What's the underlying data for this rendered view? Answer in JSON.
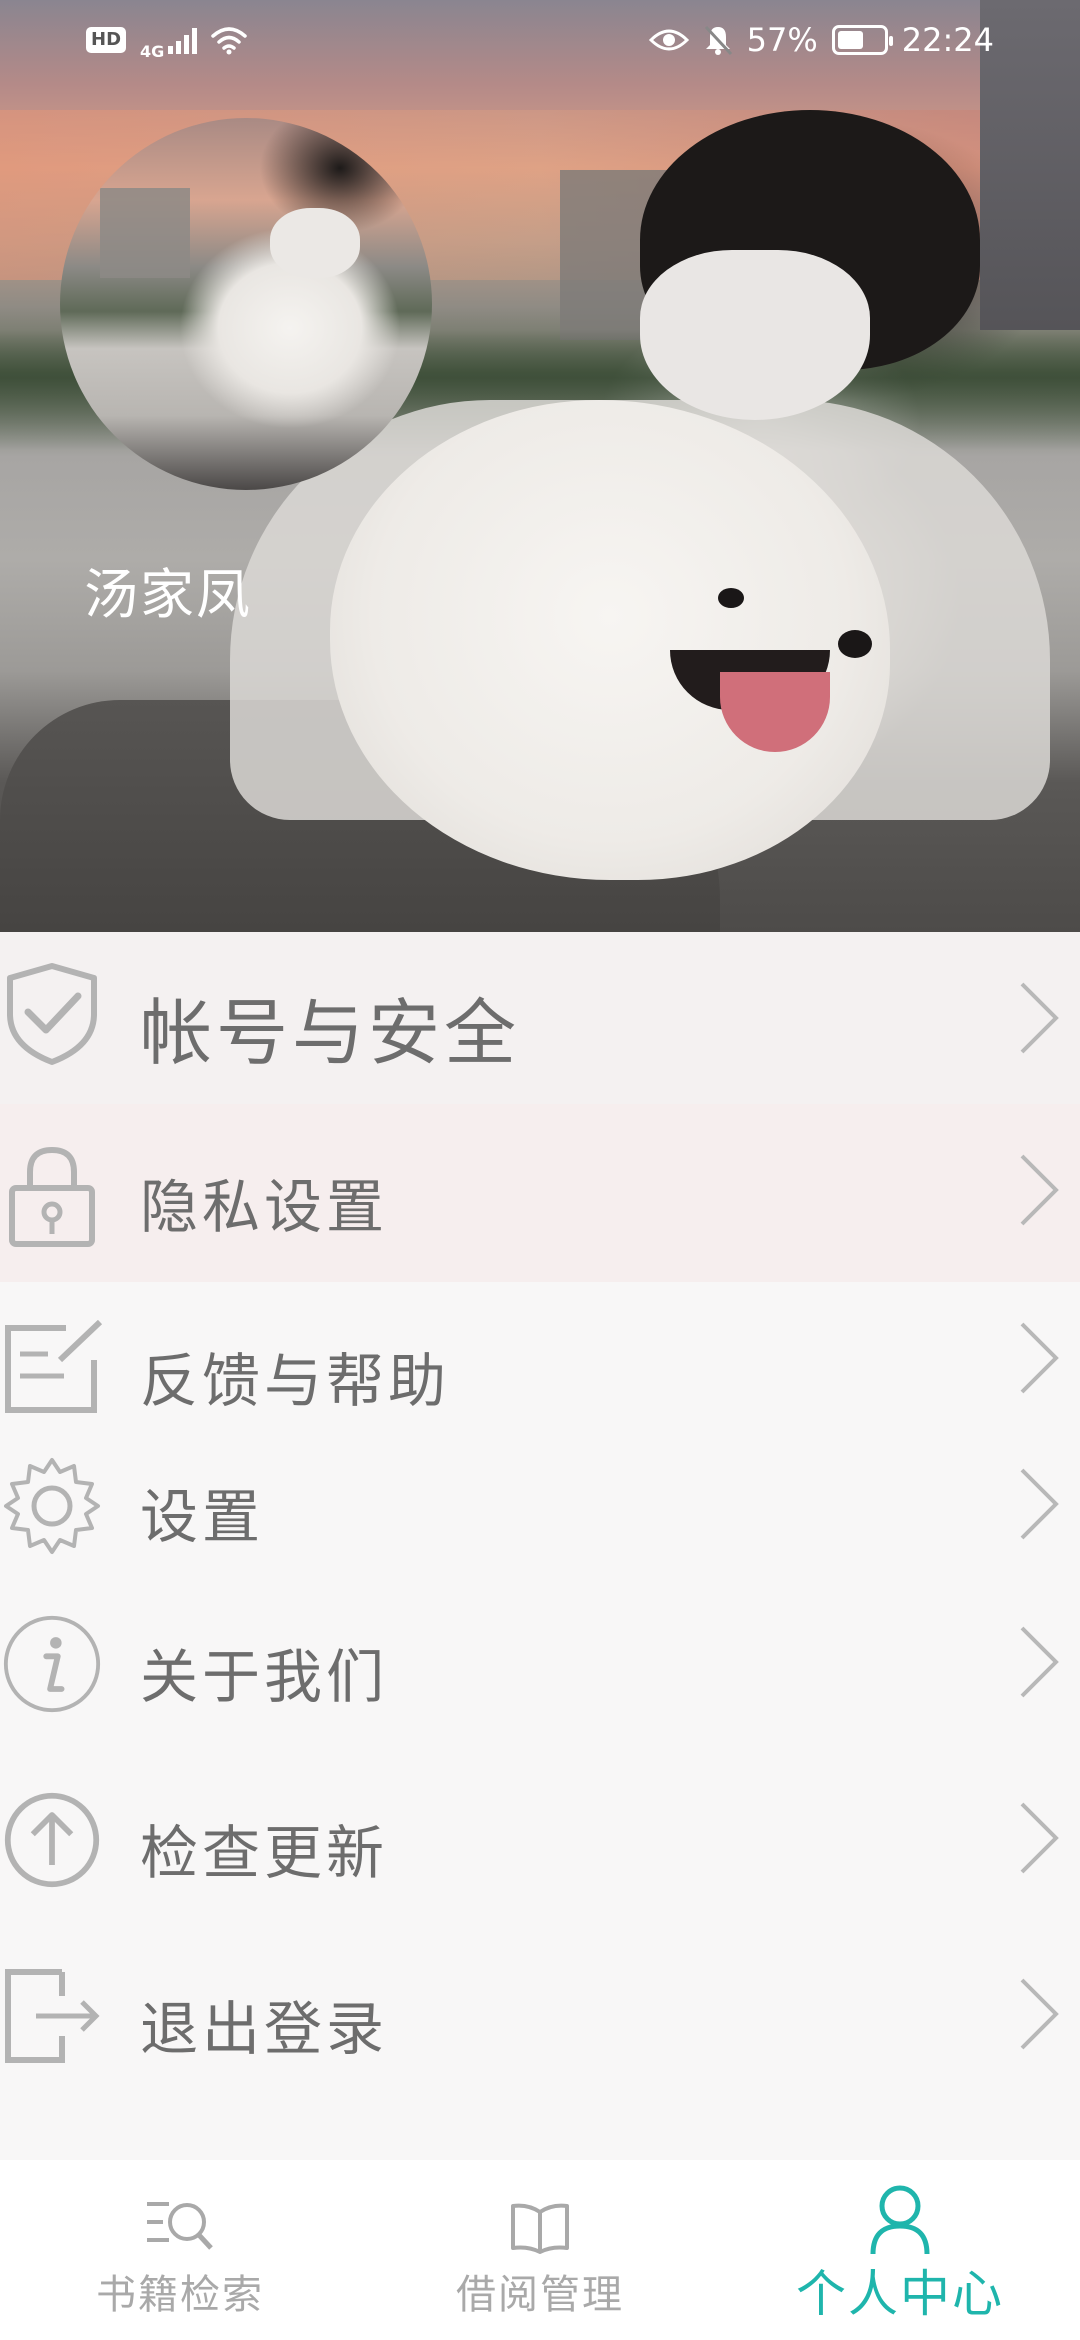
{
  "status_bar": {
    "hd": "HD",
    "network": "4G",
    "battery_percent": "57%",
    "battery_level": 0.57,
    "time": "22:24",
    "icons": [
      "hd-icon",
      "signal-icon",
      "wifi-icon",
      "eye-icon",
      "bell-off-icon",
      "battery-icon"
    ]
  },
  "profile": {
    "name": "汤家凤",
    "avatar_icon": "avatar-photo"
  },
  "menu": {
    "items": [
      {
        "label": "帐号与安全",
        "icon": "shield-check-icon"
      },
      {
        "label": "隐私设置",
        "icon": "lock-icon"
      },
      {
        "label": "反馈与帮助",
        "icon": "edit-note-icon"
      },
      {
        "label": "设置",
        "icon": "gear-icon"
      },
      {
        "label": "关于我们",
        "icon": "info-icon"
      },
      {
        "label": "检查更新",
        "icon": "upload-arrow-icon"
      },
      {
        "label": "退出登录",
        "icon": "logout-icon"
      }
    ],
    "chevron_icon": "chevron-right-icon"
  },
  "bottom_nav": {
    "tabs": [
      {
        "label": "书籍检索",
        "icon": "book-search-icon",
        "active": false
      },
      {
        "label": "借阅管理",
        "icon": "open-book-icon",
        "active": false
      },
      {
        "label": "个人中心",
        "icon": "person-icon",
        "active": true
      }
    ]
  },
  "colors": {
    "accent": "#1fb5ac",
    "text": "#6d6d6d",
    "icon": "#b3b3b3",
    "inactive_nav": "#a9a9a9"
  }
}
